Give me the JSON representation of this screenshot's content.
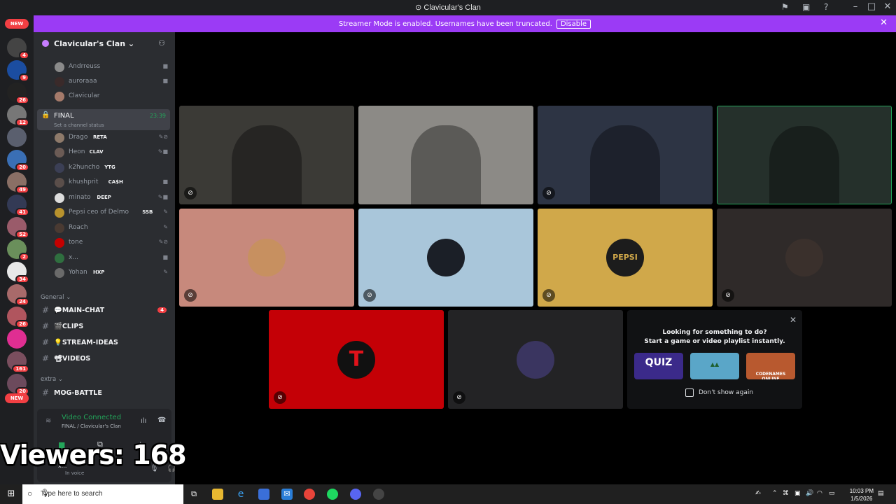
{
  "window": {
    "title": "Clavicular's Clan"
  },
  "banner": {
    "text": "Streamer Mode is enabled. Usernames have been truncated.",
    "disable": "Disable"
  },
  "guilds": {
    "new_top": "NEW",
    "new_bottom": "NEW",
    "badges": [
      "4",
      "9",
      "26",
      "12",
      "20",
      "49",
      "41",
      "52",
      "2",
      "34",
      "24",
      "26",
      "161",
      "20"
    ]
  },
  "server": {
    "name": "Clavicular's Clan"
  },
  "voice_top": [
    {
      "name": "Andrreuss"
    },
    {
      "name": "auroraaa"
    },
    {
      "name": "Clavicular"
    }
  ],
  "final_channel": {
    "name": "FINAL",
    "time": "23:39",
    "status": "Set a channel status"
  },
  "members": [
    {
      "name": "Drago",
      "tag": "RETA",
      "color": "#8e7a6a"
    },
    {
      "name": "Heon",
      "tag": "CLAV",
      "color": "#6b5b55"
    },
    {
      "name": "k2huncho",
      "tag": "YTG",
      "color": "#3b3f55"
    },
    {
      "name": "khushprit",
      "tag": "CA$H",
      "color": "#5a4e4a"
    },
    {
      "name": "minato",
      "tag": "DEEP",
      "color": "#dddddd"
    },
    {
      "name": "Pepsi ceo of Delmo",
      "tag": "SSB",
      "color": "#b8922d"
    },
    {
      "name": "Roach",
      "tag": "",
      "color": "#4a3a32"
    },
    {
      "name": "tone",
      "tag": "",
      "color": "#c40000"
    },
    {
      "name": "x...",
      "tag": "",
      "color": "#2f6f3f"
    },
    {
      "name": "Yohan",
      "tag": "HXP",
      "color": "#6a6a6a"
    }
  ],
  "categories": {
    "general": "General",
    "extra": "extra"
  },
  "text_channels": [
    {
      "name": "💬MAIN-CHAT",
      "badge": "4"
    },
    {
      "name": "🎬CLIPS",
      "badge": ""
    },
    {
      "name": "💡STREAM-IDEAS",
      "badge": ""
    },
    {
      "name": "📽VIDEOS",
      "badge": ""
    }
  ],
  "extra_channels": [
    {
      "name": "MOG-BATTLE"
    }
  ],
  "voice_panel": {
    "status": "Video Connected",
    "location": "FINAL / Clavicular's Clan",
    "user": "x...",
    "user_status": "In voice"
  },
  "overlay": {
    "viewers": "Viewers: 168"
  },
  "tiles": [
    {
      "kind": "video",
      "color": "#3b3a36"
    },
    {
      "kind": "video",
      "color": "#8c8a86"
    },
    {
      "kind": "video",
      "color": "#2d3444"
    },
    {
      "kind": "video",
      "color": "#25302b"
    },
    {
      "kind": "avatar",
      "bg": "#c7897c",
      "av": "#c79060"
    },
    {
      "kind": "avatar",
      "bg": "#a9c6da",
      "av": "#1b1f27"
    },
    {
      "kind": "avatar",
      "bg": "#d0a84a",
      "av": "#1c1c1c",
      "avtext": "PEPSI"
    },
    {
      "kind": "avatar",
      "bg": "#2f2a29",
      "av": "#3a302c"
    },
    {
      "kind": "avatar",
      "bg": "#c40006",
      "av": "#111111",
      "avtext": "T"
    },
    {
      "kind": "avatar",
      "bg": "#232325",
      "av": "#3a3560"
    }
  ],
  "suggestion": {
    "line1": "Looking for something to do?",
    "line2": "Start a game or video playlist instantly.",
    "activities": [
      "QUIZ",
      "",
      "CODENAMES ONLINE"
    ],
    "checkbox": "Don't show again"
  },
  "taskbar": {
    "search_placeholder": "Type here to search",
    "time": "10:03 PM",
    "date": "1/5/2026"
  }
}
